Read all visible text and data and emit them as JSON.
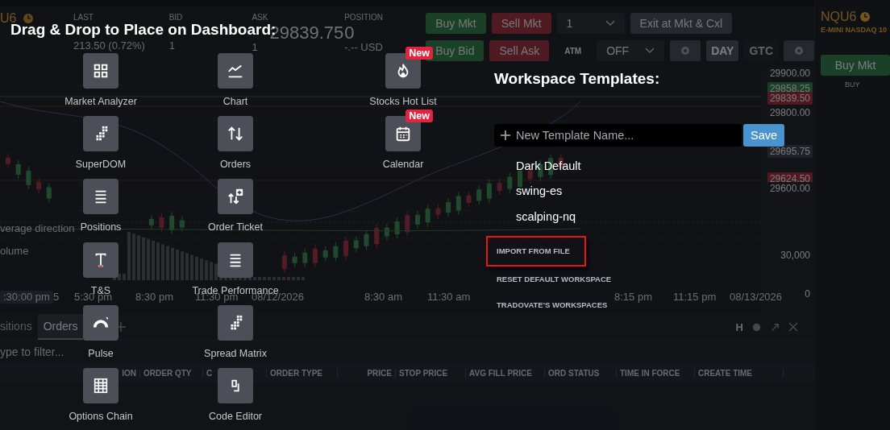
{
  "background": {
    "quote": {
      "symbol": "U6",
      "stats": [
        {
          "label": "LAST",
          "sub": "213.50 (0.72%)"
        },
        {
          "label": "BID",
          "sub": "1"
        },
        {
          "label": "ASK",
          "value": "29839.75",
          "sub": "1"
        },
        {
          "label": "POSITION",
          "value": "0",
          "sub": "-.-- USD"
        }
      ]
    },
    "order_buttons": [
      {
        "label": "Buy Mkt",
        "kind": "buy"
      },
      {
        "label": "Sell Mkt",
        "kind": "sell"
      },
      {
        "label": "1",
        "kind": "select"
      },
      {
        "label": "Exit at Mkt & Cxl",
        "kind": "exit"
      }
    ],
    "order_buttons_2": [
      {
        "label": "Buy Bid",
        "kind": "buy"
      },
      {
        "label": "Sell Ask",
        "kind": "sell"
      },
      {
        "label": "ATM",
        "kind": "label"
      },
      {
        "label": "OFF",
        "kind": "select"
      },
      {
        "kind": "gear"
      },
      {
        "label": "DAY",
        "kind": "toggle",
        "selected": true
      },
      {
        "label": "GTC",
        "kind": "toggle",
        "selected": false
      },
      {
        "kind": "gear"
      }
    ],
    "price_axis": [
      {
        "label": "29900.00",
        "kind": "tick"
      },
      {
        "label": "29858.25",
        "kind": "bid"
      },
      {
        "label": "29839.50",
        "kind": "ask"
      },
      {
        "label": "29800.00",
        "kind": "tick"
      },
      {
        "label": "29695.75",
        "kind": "level"
      },
      {
        "label": "29624.50",
        "kind": "ask"
      },
      {
        "label": "29600.00",
        "kind": "tick"
      },
      {
        "label": "30,000",
        "kind": "tick"
      },
      {
        "label": "0",
        "kind": "tick"
      }
    ],
    "indicators": [
      "verage direction",
      "olume"
    ],
    "time_axis": [
      ":30:00 pm",
      "5",
      "5:30 pm",
      "8:30 pm",
      "11:30 pm",
      "08/12/2026",
      "8:30 am",
      "11:30 am",
      "8:15 pm",
      "11:15 pm",
      "08/13/2026"
    ],
    "panel_tabs": [
      {
        "label": "sitions",
        "selected": false
      },
      {
        "label": "Orders",
        "selected": true
      }
    ],
    "panel_letter": "H",
    "filter": {
      "placeholder": "ype to filter..."
    },
    "table_columns": [
      "ION",
      "ORDER QTY",
      "C",
      "ORDER TYPE",
      "PRICE",
      "STOP PRICE",
      "AVG FILL PRICE",
      "ORD STATUS",
      "TIME IN FORCE",
      "CREATE TIME"
    ],
    "side": {
      "symbol": "NQU6",
      "name": "E-MINI NASDAQ 10",
      "button": "Buy Mkt",
      "label": "BUY"
    }
  },
  "overlay": {
    "title": "Drag & Drop to Place on Dashboard:",
    "tool_columns": [
      {
        "items": [
          {
            "label": "Market Analyzer",
            "kind": "grid"
          },
          {
            "label": "SuperDOM",
            "kind": "dom"
          },
          {
            "label": "Positions",
            "kind": "list"
          },
          {
            "label": "T&S",
            "kind": "text"
          },
          {
            "label": "Pulse",
            "kind": "gauge"
          },
          {
            "label": "Options Chain",
            "kind": "table"
          }
        ]
      },
      {
        "items": [
          {
            "label": "Chart",
            "kind": "chart"
          },
          {
            "label": "Orders",
            "kind": "orders"
          },
          {
            "label": "Order Ticket",
            "kind": "ticket"
          },
          {
            "label": "Trade Performance",
            "kind": "list"
          },
          {
            "label": "Spread Matrix",
            "kind": "dom"
          },
          {
            "label": "Code Editor",
            "kind": "code"
          }
        ]
      },
      {
        "items": [
          {
            "label": "Stocks Hot List",
            "kind": "fire",
            "badge": "New"
          },
          {
            "label": "Calendar",
            "kind": "calendar",
            "badge": "New"
          }
        ]
      }
    ],
    "templates_title": "Workspace Templates:",
    "new_template": {
      "placeholder": "New Template Name..."
    },
    "save": "Save",
    "templates": [
      "Dark Default",
      "swing-es",
      "scalping-nq"
    ],
    "actions": [
      {
        "label": "IMPORT FROM FILE",
        "highlighted": true
      },
      {
        "label": "RESET DEFAULT WORKSPACE",
        "highlighted": false
      },
      {
        "label": "TRADOVATE'S WORKSPACES",
        "highlighted": false
      }
    ]
  }
}
